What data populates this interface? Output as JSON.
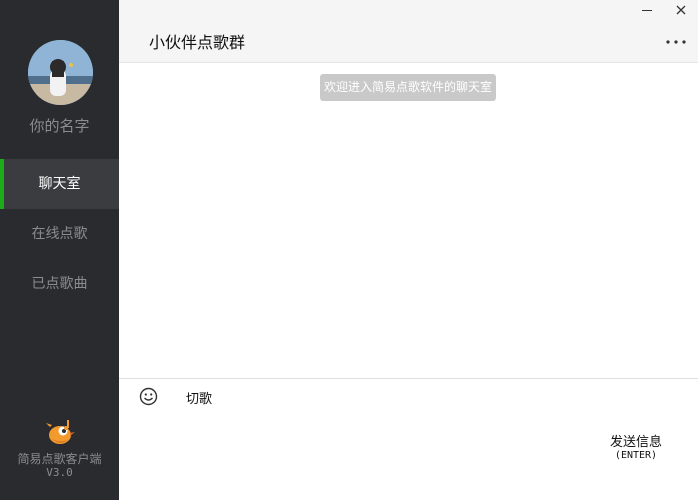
{
  "sidebar": {
    "user_name": "你的名字",
    "nav": [
      {
        "label": "聊天室",
        "active": true
      },
      {
        "label": "在线点歌",
        "active": false
      },
      {
        "label": "已点歌曲",
        "active": false
      }
    ],
    "brand": {
      "name": "简易点歌客户端",
      "version": "V3.0"
    }
  },
  "header": {
    "title": "小伙伴点歌群",
    "minimize_icon": "minimize-icon",
    "close_icon": "close-icon",
    "more_icon": "more-dots-icon"
  },
  "chat": {
    "system_message": "欢迎进入简易点歌软件的聊天室"
  },
  "composer": {
    "emoji_icon": "smiley-icon",
    "cut_song_label": "切歌",
    "input_value": "",
    "send_label": "发送信息",
    "send_shortcut": "(ENTER)"
  },
  "colors": {
    "sidebar_bg": "#2a2b2f",
    "active_nav_bg": "#3b3c40",
    "active_indicator": "#1aad19",
    "system_bubble": "#c9c9c9"
  }
}
